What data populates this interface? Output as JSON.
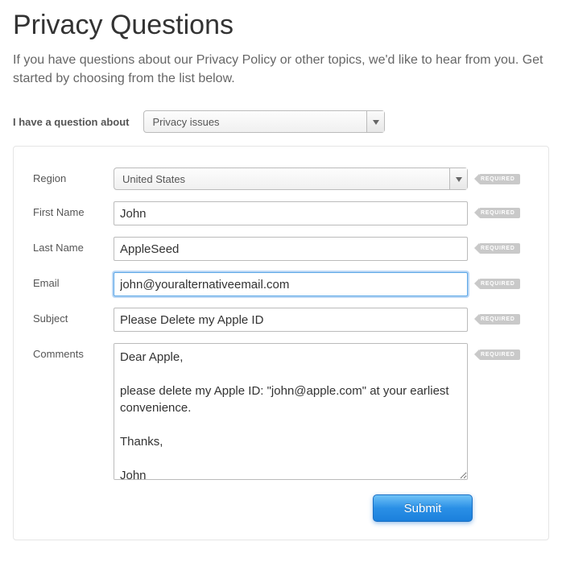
{
  "header": {
    "title": "Privacy Questions",
    "intro": "If you have questions about our Privacy Policy or other topics, we'd like to hear from you. Get started by choosing from the list below."
  },
  "topic": {
    "label": "I have a question about",
    "value": "Privacy issues"
  },
  "form": {
    "required_label": "REQUIRED",
    "fields": {
      "region": {
        "label": "Region",
        "value": "United States"
      },
      "first_name": {
        "label": "First Name",
        "value": "John"
      },
      "last_name": {
        "label": "Last Name",
        "value": "AppleSeed"
      },
      "email": {
        "label": "Email",
        "value": "john@youralternativeemail.com"
      },
      "subject": {
        "label": "Subject",
        "value": "Please Delete my Apple ID"
      },
      "comments": {
        "label": "Comments",
        "value": "Dear Apple,\n\nplease delete my Apple ID: \"john@apple.com\" at your earliest convenience.\n\nThanks,\n\nJohn"
      }
    },
    "submit_label": "Submit"
  }
}
